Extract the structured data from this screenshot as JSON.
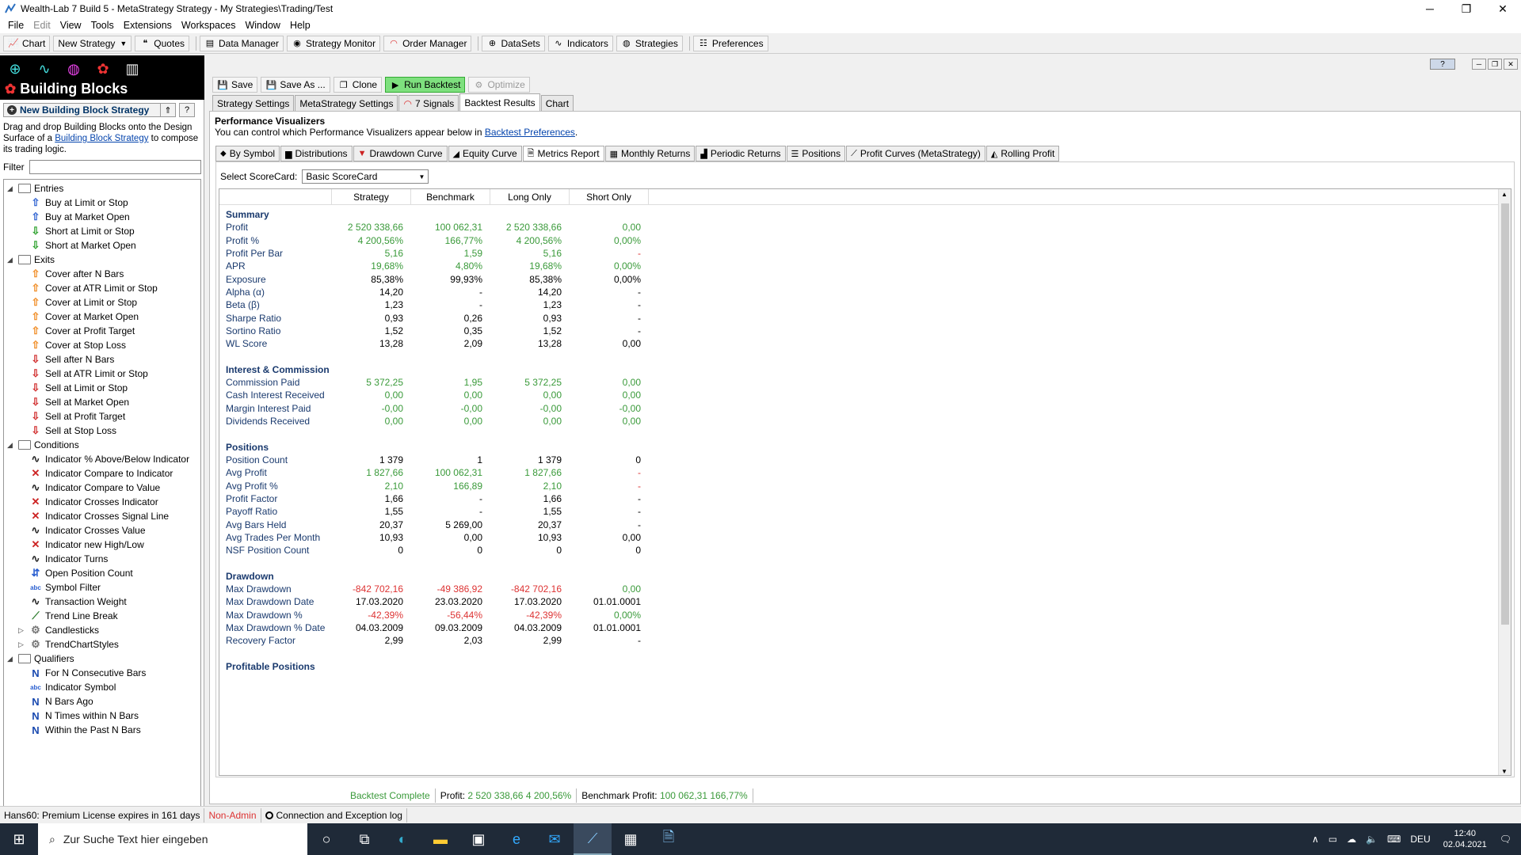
{
  "window": {
    "title": "Wealth-Lab 7 Build 5 - MetaStrategy Strategy - My Strategies\\Trading/Test",
    "minimize": "─",
    "maximize": "❐",
    "close": "✕"
  },
  "menu": [
    "File",
    "Edit",
    "View",
    "Tools",
    "Extensions",
    "Workspaces",
    "Window",
    "Help"
  ],
  "toolbar": {
    "chart": "Chart",
    "new_strategy": "New Strategy",
    "quotes": "Quotes",
    "data_manager": "Data Manager",
    "strategy_monitor": "Strategy Monitor",
    "order_manager": "Order Manager",
    "datasets": "DataSets",
    "indicators": "Indicators",
    "strategies": "Strategies",
    "preferences": "Preferences"
  },
  "left": {
    "title": "Building Blocks",
    "new_button": "New Building Block Strategy",
    "desc_1": "Drag and drop Building Blocks onto the Design Surface of a ",
    "desc_link": "Building Block Strategy",
    "desc_2": " to compose its trading logic.",
    "filter_label": "Filter",
    "tree": [
      {
        "t": "folder",
        "label": "Entries",
        "lvl": 0
      },
      {
        "t": "up",
        "label": "Buy at Limit or Stop",
        "lvl": 1,
        "c": "#2a5fd0"
      },
      {
        "t": "up",
        "label": "Buy at Market Open",
        "lvl": 1,
        "c": "#2a5fd0"
      },
      {
        "t": "down",
        "label": "Short at Limit or Stop",
        "lvl": 1,
        "c": "#2aa02a"
      },
      {
        "t": "down",
        "label": "Short at Market Open",
        "lvl": 1,
        "c": "#2aa02a"
      },
      {
        "t": "folder",
        "label": "Exits",
        "lvl": 0
      },
      {
        "t": "up",
        "label": "Cover after N Bars",
        "lvl": 1,
        "c": "#f08a20"
      },
      {
        "t": "up",
        "label": "Cover at ATR Limit or Stop",
        "lvl": 1,
        "c": "#f08a20"
      },
      {
        "t": "up",
        "label": "Cover at Limit or Stop",
        "lvl": 1,
        "c": "#f08a20"
      },
      {
        "t": "up",
        "label": "Cover at Market Open",
        "lvl": 1,
        "c": "#f08a20"
      },
      {
        "t": "up",
        "label": "Cover at Profit Target",
        "lvl": 1,
        "c": "#f08a20"
      },
      {
        "t": "up",
        "label": "Cover at Stop Loss",
        "lvl": 1,
        "c": "#f08a20"
      },
      {
        "t": "down",
        "label": "Sell after N Bars",
        "lvl": 1,
        "c": "#d02a2a"
      },
      {
        "t": "down",
        "label": "Sell at ATR Limit or Stop",
        "lvl": 1,
        "c": "#d02a2a"
      },
      {
        "t": "down",
        "label": "Sell at Limit or Stop",
        "lvl": 1,
        "c": "#d02a2a"
      },
      {
        "t": "down",
        "label": "Sell at Market Open",
        "lvl": 1,
        "c": "#d02a2a"
      },
      {
        "t": "down",
        "label": "Sell at Profit Target",
        "lvl": 1,
        "c": "#d02a2a"
      },
      {
        "t": "down",
        "label": "Sell at Stop Loss",
        "lvl": 1,
        "c": "#d02a2a"
      },
      {
        "t": "folder",
        "label": "Conditions",
        "lvl": 0
      },
      {
        "t": "wave",
        "label": "Indicator % Above/Below Indicator",
        "lvl": 1,
        "c": "#222"
      },
      {
        "t": "cross",
        "label": "Indicator Compare to Indicator",
        "lvl": 1,
        "c": "#c22"
      },
      {
        "t": "wave",
        "label": "Indicator Compare to Value",
        "lvl": 1,
        "c": "#222"
      },
      {
        "t": "cross",
        "label": "Indicator Crosses Indicator",
        "lvl": 1,
        "c": "#c22"
      },
      {
        "t": "cross",
        "label": "Indicator Crosses Signal Line",
        "lvl": 1,
        "c": "#c22"
      },
      {
        "t": "wave",
        "label": "Indicator Crosses Value",
        "lvl": 1,
        "c": "#222"
      },
      {
        "t": "cross",
        "label": "Indicator new High/Low",
        "lvl": 1,
        "c": "#c22"
      },
      {
        "t": "wave",
        "label": "Indicator Turns",
        "lvl": 1,
        "c": "#222"
      },
      {
        "t": "updown",
        "label": "Open Position Count",
        "lvl": 1,
        "c": "#2a5fd0"
      },
      {
        "t": "abc",
        "label": "Symbol Filter",
        "lvl": 1,
        "c": "#2a5fd0"
      },
      {
        "t": "wave",
        "label": "Transaction Weight",
        "lvl": 1,
        "c": "#222"
      },
      {
        "t": "trend",
        "label": "Trend Line Break",
        "lvl": 1,
        "c": "#2a7a2a"
      },
      {
        "t": "gear",
        "label": "Candlesticks",
        "lvl": 1,
        "c": "#777"
      },
      {
        "t": "gear",
        "label": "TrendChartStyles",
        "lvl": 1,
        "c": "#777"
      },
      {
        "t": "folder",
        "label": "Qualifiers",
        "lvl": 0
      },
      {
        "t": "N",
        "label": "For N Consecutive Bars",
        "lvl": 1,
        "c": "#1a4ab0"
      },
      {
        "t": "abc",
        "label": "Indicator Symbol",
        "lvl": 1,
        "c": "#2a5fd0"
      },
      {
        "t": "N",
        "label": "N Bars Ago",
        "lvl": 1,
        "c": "#1a4ab0"
      },
      {
        "t": "N",
        "label": "N Times within N Bars",
        "lvl": 1,
        "c": "#1a4ab0"
      },
      {
        "t": "N",
        "label": "Within the Past N Bars",
        "lvl": 1,
        "c": "#1a4ab0"
      }
    ]
  },
  "strategy_toolbar": {
    "save": "Save",
    "save_as": "Save As ...",
    "clone": "Clone",
    "run": "Run Backtest",
    "optimize": "Optimize"
  },
  "strategy_tabs": [
    "Strategy Settings",
    "MetaStrategy Settings",
    "7 Signals",
    "Backtest Results",
    "Chart"
  ],
  "pv": {
    "title": "Performance Visualizers",
    "desc": "You can control which Performance Visualizers appear below in ",
    "link": "Backtest Preferences",
    "tail": "."
  },
  "vis_tabs": [
    "By Symbol",
    "Distributions",
    "Drawdown Curve",
    "Equity Curve",
    "Metrics Report",
    "Monthly Returns",
    "Periodic Returns",
    "Positions",
    "Profit Curves (MetaStrategy)",
    "Rolling Profit"
  ],
  "scorecard": {
    "label": "Select ScoreCard:",
    "value": "Basic ScoreCard"
  },
  "columns": [
    "Strategy",
    "Benchmark",
    "Long Only",
    "Short Only"
  ],
  "sections": [
    {
      "name": "Summary",
      "rows": [
        [
          "Profit",
          "2 520 338,66",
          "100 062,31",
          "2 520 338,66",
          "0,00",
          "g"
        ],
        [
          "Profit %",
          "4 200,56%",
          "166,77%",
          "4 200,56%",
          "0,00%",
          "g"
        ],
        [
          "Profit Per Bar",
          "5,16",
          "1,59",
          "5,16",
          "-",
          "g"
        ],
        [
          "APR",
          "19,68%",
          "4,80%",
          "19,68%",
          "0,00%",
          "g"
        ],
        [
          "Exposure",
          "85,38%",
          "99,93%",
          "85,38%",
          "0,00%",
          "k"
        ],
        [
          "Alpha (α)",
          "14,20",
          "-",
          "14,20",
          "-",
          "k"
        ],
        [
          "Beta (β)",
          "1,23",
          "-",
          "1,23",
          "-",
          "k"
        ],
        [
          "Sharpe Ratio",
          "0,93",
          "0,26",
          "0,93",
          "-",
          "k"
        ],
        [
          "Sortino Ratio",
          "1,52",
          "0,35",
          "1,52",
          "-",
          "k"
        ],
        [
          "WL Score",
          "13,28",
          "2,09",
          "13,28",
          "0,00",
          "k"
        ]
      ]
    },
    {
      "name": "Interest & Commission",
      "rows": [
        [
          "Commission Paid",
          "5 372,25",
          "1,95",
          "5 372,25",
          "0,00",
          "g"
        ],
        [
          "Cash Interest Received",
          "0,00",
          "0,00",
          "0,00",
          "0,00",
          "g"
        ],
        [
          "Margin Interest Paid",
          "-0,00",
          "-0,00",
          "-0,00",
          "-0,00",
          "g"
        ],
        [
          "Dividends Received",
          "0,00",
          "0,00",
          "0,00",
          "0,00",
          "g"
        ]
      ]
    },
    {
      "name": "Positions",
      "rows": [
        [
          "Position Count",
          "1 379",
          "1",
          "1 379",
          "0",
          "k"
        ],
        [
          "Avg Profit",
          "1 827,66",
          "100 062,31",
          "1 827,66",
          "-",
          "g"
        ],
        [
          "Avg Profit %",
          "2,10",
          "166,89",
          "2,10",
          "-",
          "g"
        ],
        [
          "Profit Factor",
          "1,66",
          "-",
          "1,66",
          "-",
          "k"
        ],
        [
          "Payoff Ratio",
          "1,55",
          "-",
          "1,55",
          "-",
          "k"
        ],
        [
          "Avg Bars Held",
          "20,37",
          "5 269,00",
          "20,37",
          "-",
          "k"
        ],
        [
          "Avg Trades Per Month",
          "10,93",
          "0,00",
          "10,93",
          "0,00",
          "k"
        ],
        [
          "NSF Position Count",
          "0",
          "0",
          "0",
          "0",
          "k"
        ]
      ]
    },
    {
      "name": "Drawdown",
      "rows": [
        [
          "Max Drawdown",
          "-842 702,16",
          "-49 386,92",
          "-842 702,16",
          "0,00",
          "r"
        ],
        [
          "Max Drawdown Date",
          "17.03.2020",
          "23.03.2020",
          "17.03.2020",
          "01.01.0001",
          "k"
        ],
        [
          "Max Drawdown %",
          "-42,39%",
          "-56,44%",
          "-42,39%",
          "0,00%",
          "r"
        ],
        [
          "Max Drawdown % Date",
          "04.03.2009",
          "09.03.2009",
          "04.03.2009",
          "01.01.0001",
          "k"
        ],
        [
          "Recovery Factor",
          "2,99",
          "2,03",
          "2,99",
          "-",
          "k"
        ]
      ]
    },
    {
      "name": "Profitable Positions",
      "rows": []
    }
  ],
  "bottom_status": {
    "complete": "Backtest Complete",
    "profit_label": "Profit:",
    "profit": "2 520 338,66",
    "profit_pct": "4 200,56%",
    "bench_label": "Benchmark Profit:",
    "bench": "100 062,31",
    "bench_pct": "166,77%"
  },
  "status": {
    "license": "Hans60: Premium License expires in 161 days",
    "admin": "Non-Admin",
    "log": "Connection and Exception log"
  },
  "taskbar": {
    "search": "Zur Suche Text hier eingeben",
    "lang": "DEU",
    "time": "12:40",
    "date": "02.04.2021"
  },
  "colors": {
    "green": "#3a9a3a",
    "red": "#d33",
    "label": "#1a3a6e"
  }
}
